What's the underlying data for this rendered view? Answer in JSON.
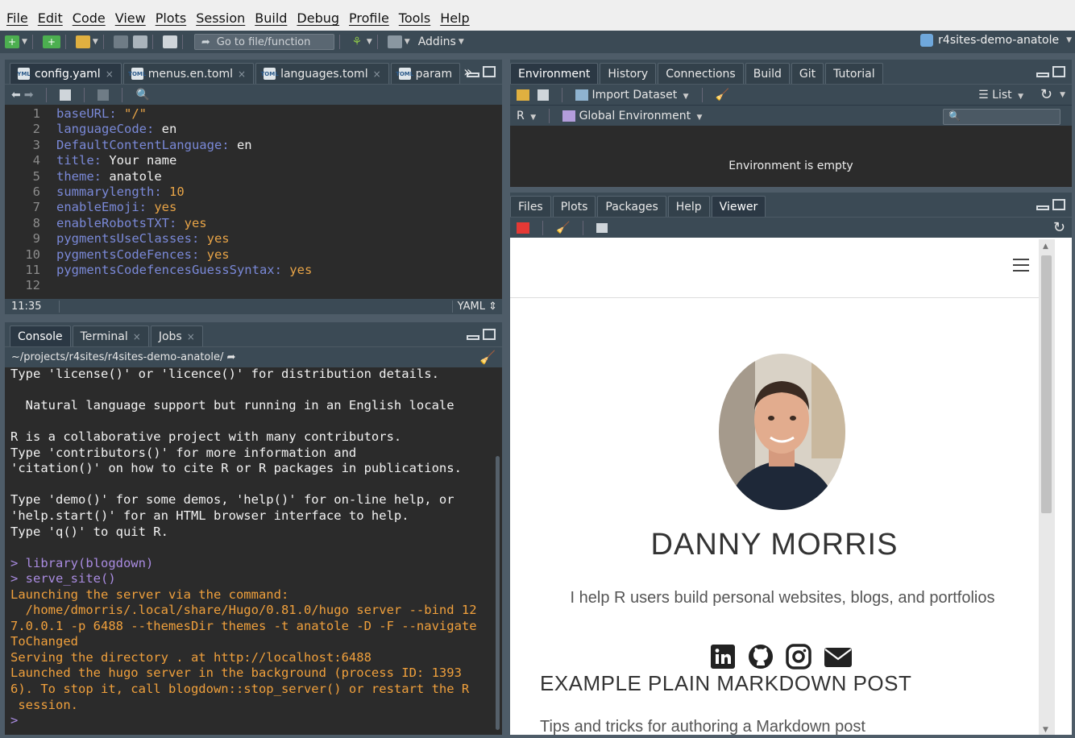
{
  "menubar": [
    "File",
    "Edit",
    "Code",
    "View",
    "Plots",
    "Session",
    "Build",
    "Debug",
    "Profile",
    "Tools",
    "Help"
  ],
  "toolbar": {
    "goto_placeholder": "Go to file/function",
    "addins_label": "Addins",
    "project_name": "r4sites-demo-anatole"
  },
  "editor": {
    "tabs": [
      "config.yaml",
      "menus.en.toml",
      "languages.toml",
      "param"
    ],
    "lines": [
      {
        "n": "1",
        "k": "baseURL:",
        "v": " \"/\"",
        "c": "or"
      },
      {
        "n": "2",
        "k": "languageCode:",
        "v": " en",
        "c": ""
      },
      {
        "n": "3",
        "k": "DefaultContentLanguage:",
        "v": " en",
        "c": ""
      },
      {
        "n": "4",
        "k": "title:",
        "v": " Your name",
        "c": ""
      },
      {
        "n": "5",
        "k": "theme:",
        "v": " anatole",
        "c": ""
      },
      {
        "n": "6",
        "k": "summarylength:",
        "v": " 10",
        "c": "or"
      },
      {
        "n": "7",
        "k": "enableEmoji:",
        "v": " yes",
        "c": "or"
      },
      {
        "n": "8",
        "k": "enableRobotsTXT:",
        "v": " yes",
        "c": "or"
      },
      {
        "n": "9",
        "k": "pygmentsUseClasses:",
        "v": " yes",
        "c": "or"
      },
      {
        "n": "10",
        "k": "pygmentsCodeFences:",
        "v": " yes",
        "c": "or"
      },
      {
        "n": "11",
        "k": "pygmentsCodefencesGuessSyntax:",
        "v": " yes",
        "c": "or"
      },
      {
        "n": "12",
        "k": "",
        "v": "",
        "c": ""
      }
    ],
    "cursor_pos": "11:35",
    "file_type": "YAML"
  },
  "console": {
    "tabs": [
      "Console",
      "Terminal",
      "Jobs"
    ],
    "path": "~/projects/r4sites/r4sites-demo-anatole/",
    "lines": [
      {
        "t": "Type 'license()' or 'licence()' for distribution details.",
        "c": ""
      },
      {
        "t": "",
        "c": ""
      },
      {
        "t": "  Natural language support but running in an English locale",
        "c": ""
      },
      {
        "t": "",
        "c": ""
      },
      {
        "t": "R is a collaborative project with many contributors.",
        "c": ""
      },
      {
        "t": "Type 'contributors()' for more information and",
        "c": ""
      },
      {
        "t": "'citation()' on how to cite R or R packages in publications.",
        "c": ""
      },
      {
        "t": "",
        "c": ""
      },
      {
        "t": "Type 'demo()' for some demos, 'help()' for on-line help, or",
        "c": ""
      },
      {
        "t": "'help.start()' for an HTML browser interface to help.",
        "c": ""
      },
      {
        "t": "Type 'q()' to quit R.",
        "c": ""
      },
      {
        "t": "",
        "c": ""
      },
      {
        "t": "> library(blogdown)",
        "c": "prompt"
      },
      {
        "t": "> serve_site()",
        "c": "prompt"
      },
      {
        "t": "Launching the server via the command:",
        "c": "msg"
      },
      {
        "t": "  /home/dmorris/.local/share/Hugo/0.81.0/hugo server --bind 12",
        "c": "msg"
      },
      {
        "t": "7.0.0.1 -p 6488 --themesDir themes -t anatole -D -F --navigate",
        "c": "msg"
      },
      {
        "t": "ToChanged",
        "c": "msg"
      },
      {
        "t": "Serving the directory . at http://localhost:6488",
        "c": "msg"
      },
      {
        "t": "Launched the hugo server in the background (process ID: 1393",
        "c": "msg"
      },
      {
        "t": "6). To stop it, call blogdown::stop_server() or restart the R",
        "c": "msg"
      },
      {
        "t": " session.",
        "c": "msg"
      },
      {
        "t": ">",
        "c": "prompt"
      }
    ]
  },
  "environment": {
    "tabs": [
      "Environment",
      "History",
      "Connections",
      "Build",
      "Git",
      "Tutorial"
    ],
    "import_label": "Import Dataset",
    "list_label": "List",
    "r_label": "R",
    "scope_label": "Global Environment",
    "empty_text": "Environment is empty"
  },
  "viewer": {
    "tabs": [
      "Files",
      "Plots",
      "Packages",
      "Help",
      "Viewer"
    ],
    "site": {
      "name": "DANNY MORRIS",
      "tagline": "I help R users build personal websites, blogs, and portfolios",
      "post_title": "EXAMPLE PLAIN MARKDOWN POST",
      "post_subtitle": "Tips and tricks for authoring a Markdown post",
      "social_icons": [
        "linkedin-icon",
        "github-icon",
        "instagram-icon",
        "email-icon"
      ]
    }
  },
  "colors": {
    "chrome": "#3b4a55",
    "editor_bg": "#2b2b2b",
    "keyword": "#7a89d8",
    "string": "#e8a447",
    "console_msg": "#f0a03c"
  }
}
